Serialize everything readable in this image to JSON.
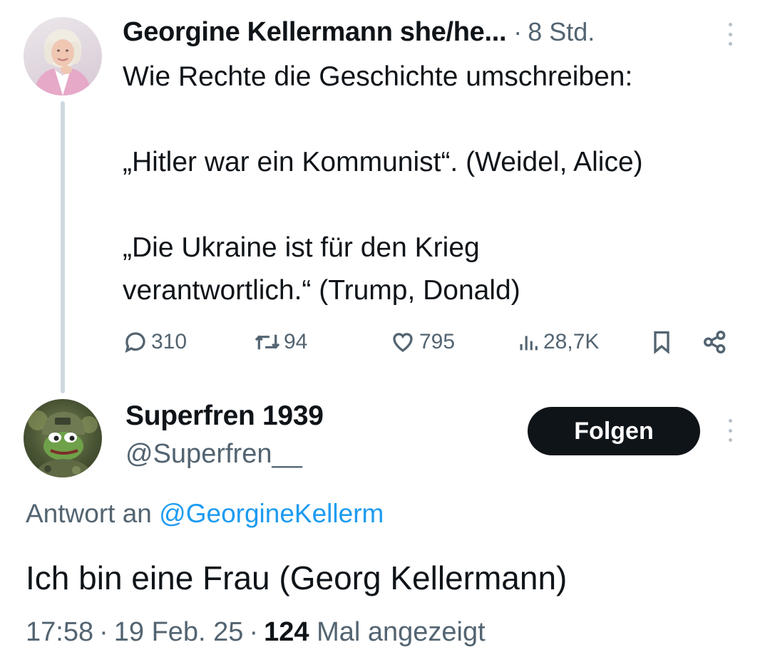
{
  "parent_tweet": {
    "author_name": "Georgine Kellermann she/he...",
    "separator": "·",
    "time_ago": "8 Std.",
    "text_lines": [
      "Wie Rechte die Geschichte umschreiben:",
      "",
      "„Hitler war ein Kommunist“. (Weidel, Alice)",
      "",
      "„Die Ukraine ist für den Krieg",
      "verantwortlich.“ (Trump, Donald)"
    ],
    "actions": {
      "replies": "310",
      "reposts": "94",
      "likes": "795",
      "views": "28,7K"
    },
    "icons": [
      "reply-icon",
      "repost-icon",
      "like-icon",
      "views-icon",
      "bookmark-icon",
      "share-icon",
      "more-icon"
    ]
  },
  "reply_tweet": {
    "author_name": "Superfren 1939",
    "handle": "@Superfren__",
    "follow_label": "Folgen",
    "reply_prefix": "Antwort an ",
    "reply_mention": "@GeorgineKellerm",
    "text": "Ich bin eine Frau (Georg Kellermann)",
    "time": "17:58",
    "separator": "·",
    "date": "19 Feb. 25",
    "views_count": "124",
    "views_label": "Mal angezeigt"
  },
  "colors": {
    "text_primary": "#0f1419",
    "text_secondary": "#536471",
    "link": "#1d9bf0",
    "thread_line": "#cfd9de",
    "button_bg": "#0f1419"
  }
}
